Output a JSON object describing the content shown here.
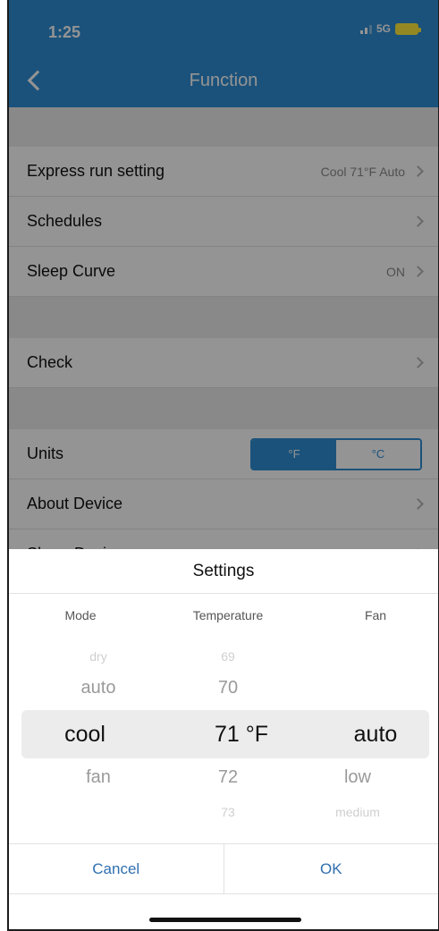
{
  "status": {
    "time": "1:25",
    "network": "5G"
  },
  "header": {
    "title": "Function"
  },
  "list": {
    "express": {
      "label": "Express run setting",
      "value": "Cool 71°F Auto"
    },
    "schedules": {
      "label": "Schedules"
    },
    "sleep": {
      "label": "Sleep Curve",
      "value": "ON"
    },
    "check": {
      "label": "Check"
    },
    "units": {
      "label": "Units",
      "options": [
        "°F",
        "°C"
      ],
      "selected": "°F"
    },
    "about": {
      "label": "About Device"
    },
    "share": {
      "label": "Share Device"
    }
  },
  "picker": {
    "title": "Settings",
    "columns": [
      "Mode",
      "Temperature",
      "Fan"
    ],
    "mode": {
      "far_above": "dry",
      "above": "auto",
      "selected": "cool",
      "below": "fan"
    },
    "temperature": {
      "far_above": "69",
      "above": "70",
      "selected": "71 °F",
      "below": "72",
      "far_below": "73"
    },
    "fan": {
      "selected": "auto",
      "below": "low",
      "far_below": "medium"
    },
    "cancel": "Cancel",
    "ok": "OK"
  },
  "colors": {
    "accent": "#2f8ed4",
    "link": "#2f6fb0"
  }
}
